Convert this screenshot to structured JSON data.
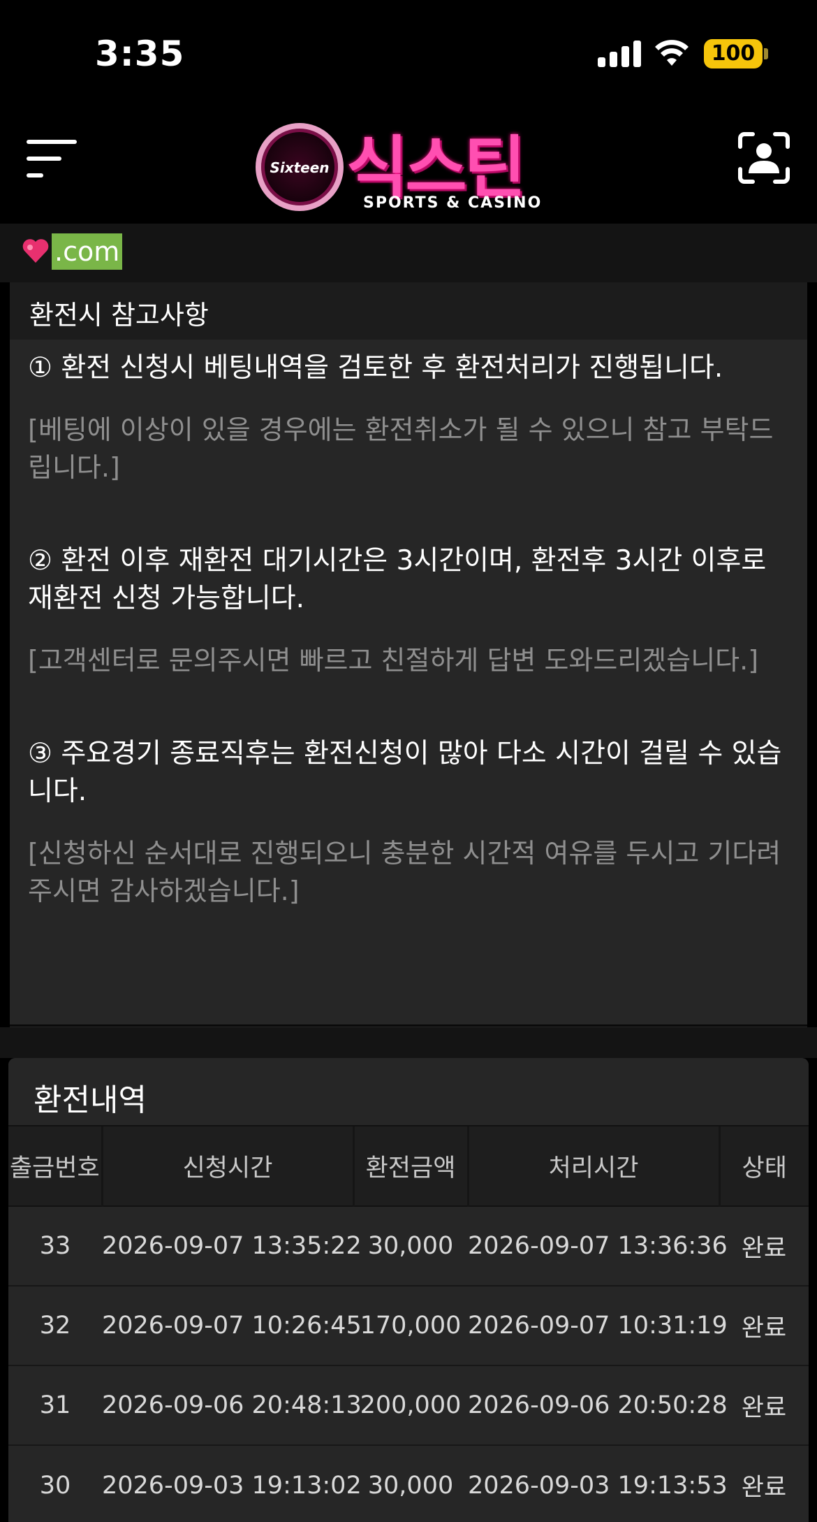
{
  "status_bar": {
    "time": "3:35",
    "battery": "100"
  },
  "header": {
    "logo_badge": "Sixteen",
    "logo_title": "식스틴",
    "logo_subtitle": "SPORTS & CASINO"
  },
  "domain": {
    "text": ".com"
  },
  "notice": {
    "title": "환전시 참고사항",
    "items": [
      {
        "main": "① 환전 신청시 베팅내역을 검토한 후 환전처리가 진행됩니다.",
        "sub": "[베팅에 이상이 있을 경우에는 환전취소가 될 수 있으니 참고 부탁드립니다.]"
      },
      {
        "main": "② 환전 이후 재환전 대기시간은 3시간이며, 환전후 3시간 이후로 재환전 신청 가능합니다.",
        "sub": "[고객센터로 문의주시면 빠르고 친절하게 답변 도와드리겠습니다.]"
      },
      {
        "main": "③ 주요경기 종료직후는 환전신청이 많아 다소 시간이 걸릴 수 있습니다.",
        "sub": "[신청하신 순서대로 진행되오니 충분한 시간적 여유를 두시고 기다려 주시면 감사하겠습니다.]"
      }
    ]
  },
  "history": {
    "title": "환전내역",
    "columns": [
      "출금번호",
      "신청시간",
      "환전금액",
      "처리시간",
      "상태"
    ],
    "rows": [
      {
        "no": "33",
        "requested": "2026-09-07 13:35:22",
        "amount": "30,000",
        "processed": "2026-09-07 13:36:36",
        "status": "완료"
      },
      {
        "no": "32",
        "requested": "2026-09-07 10:26:45",
        "amount": "170,000",
        "processed": "2026-09-07 10:31:19",
        "status": "완료"
      },
      {
        "no": "31",
        "requested": "2026-09-06 20:48:13",
        "amount": "200,000",
        "processed": "2026-09-06 20:50:28",
        "status": "완료"
      },
      {
        "no": "30",
        "requested": "2026-09-03 19:13:02",
        "amount": "30,000",
        "processed": "2026-09-03 19:13:53",
        "status": "완료"
      }
    ]
  }
}
